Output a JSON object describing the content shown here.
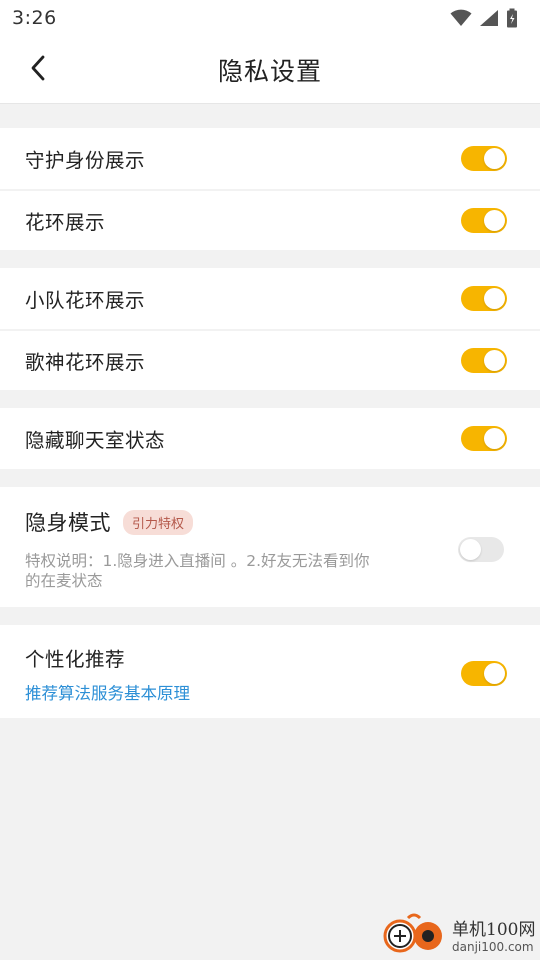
{
  "status_bar": {
    "time": "3:26",
    "icons": [
      "wifi-icon",
      "cell-signal-icon",
      "battery-icon"
    ]
  },
  "nav": {
    "title": "隐私设置",
    "back_icon": "chevron-left-icon"
  },
  "groups": [
    {
      "items": [
        {
          "label": "守护身份展示",
          "on": true
        },
        {
          "label": "花环展示",
          "on": true
        }
      ]
    },
    {
      "items": [
        {
          "label": "小队花环展示",
          "on": true
        },
        {
          "label": "歌神花环展示",
          "on": true
        }
      ]
    },
    {
      "items": [
        {
          "label": "隐藏聊天室状态",
          "on": true
        }
      ]
    }
  ],
  "stealth": {
    "title": "隐身模式",
    "badge": "引力特权",
    "desc_line1": "特权说明：1.隐身进入直播间 。2.好友无法看到你",
    "desc_line2": "的在麦状态",
    "on": false
  },
  "personalize": {
    "title": "个性化推荐",
    "link": "推荐算法服务基本原理",
    "on": true
  },
  "watermark": {
    "line1": "单机100网",
    "line2": "danji100.com"
  },
  "colors": {
    "accent": "#f7b500",
    "link": "#2c8fd6",
    "background": "#f2f2f2"
  }
}
